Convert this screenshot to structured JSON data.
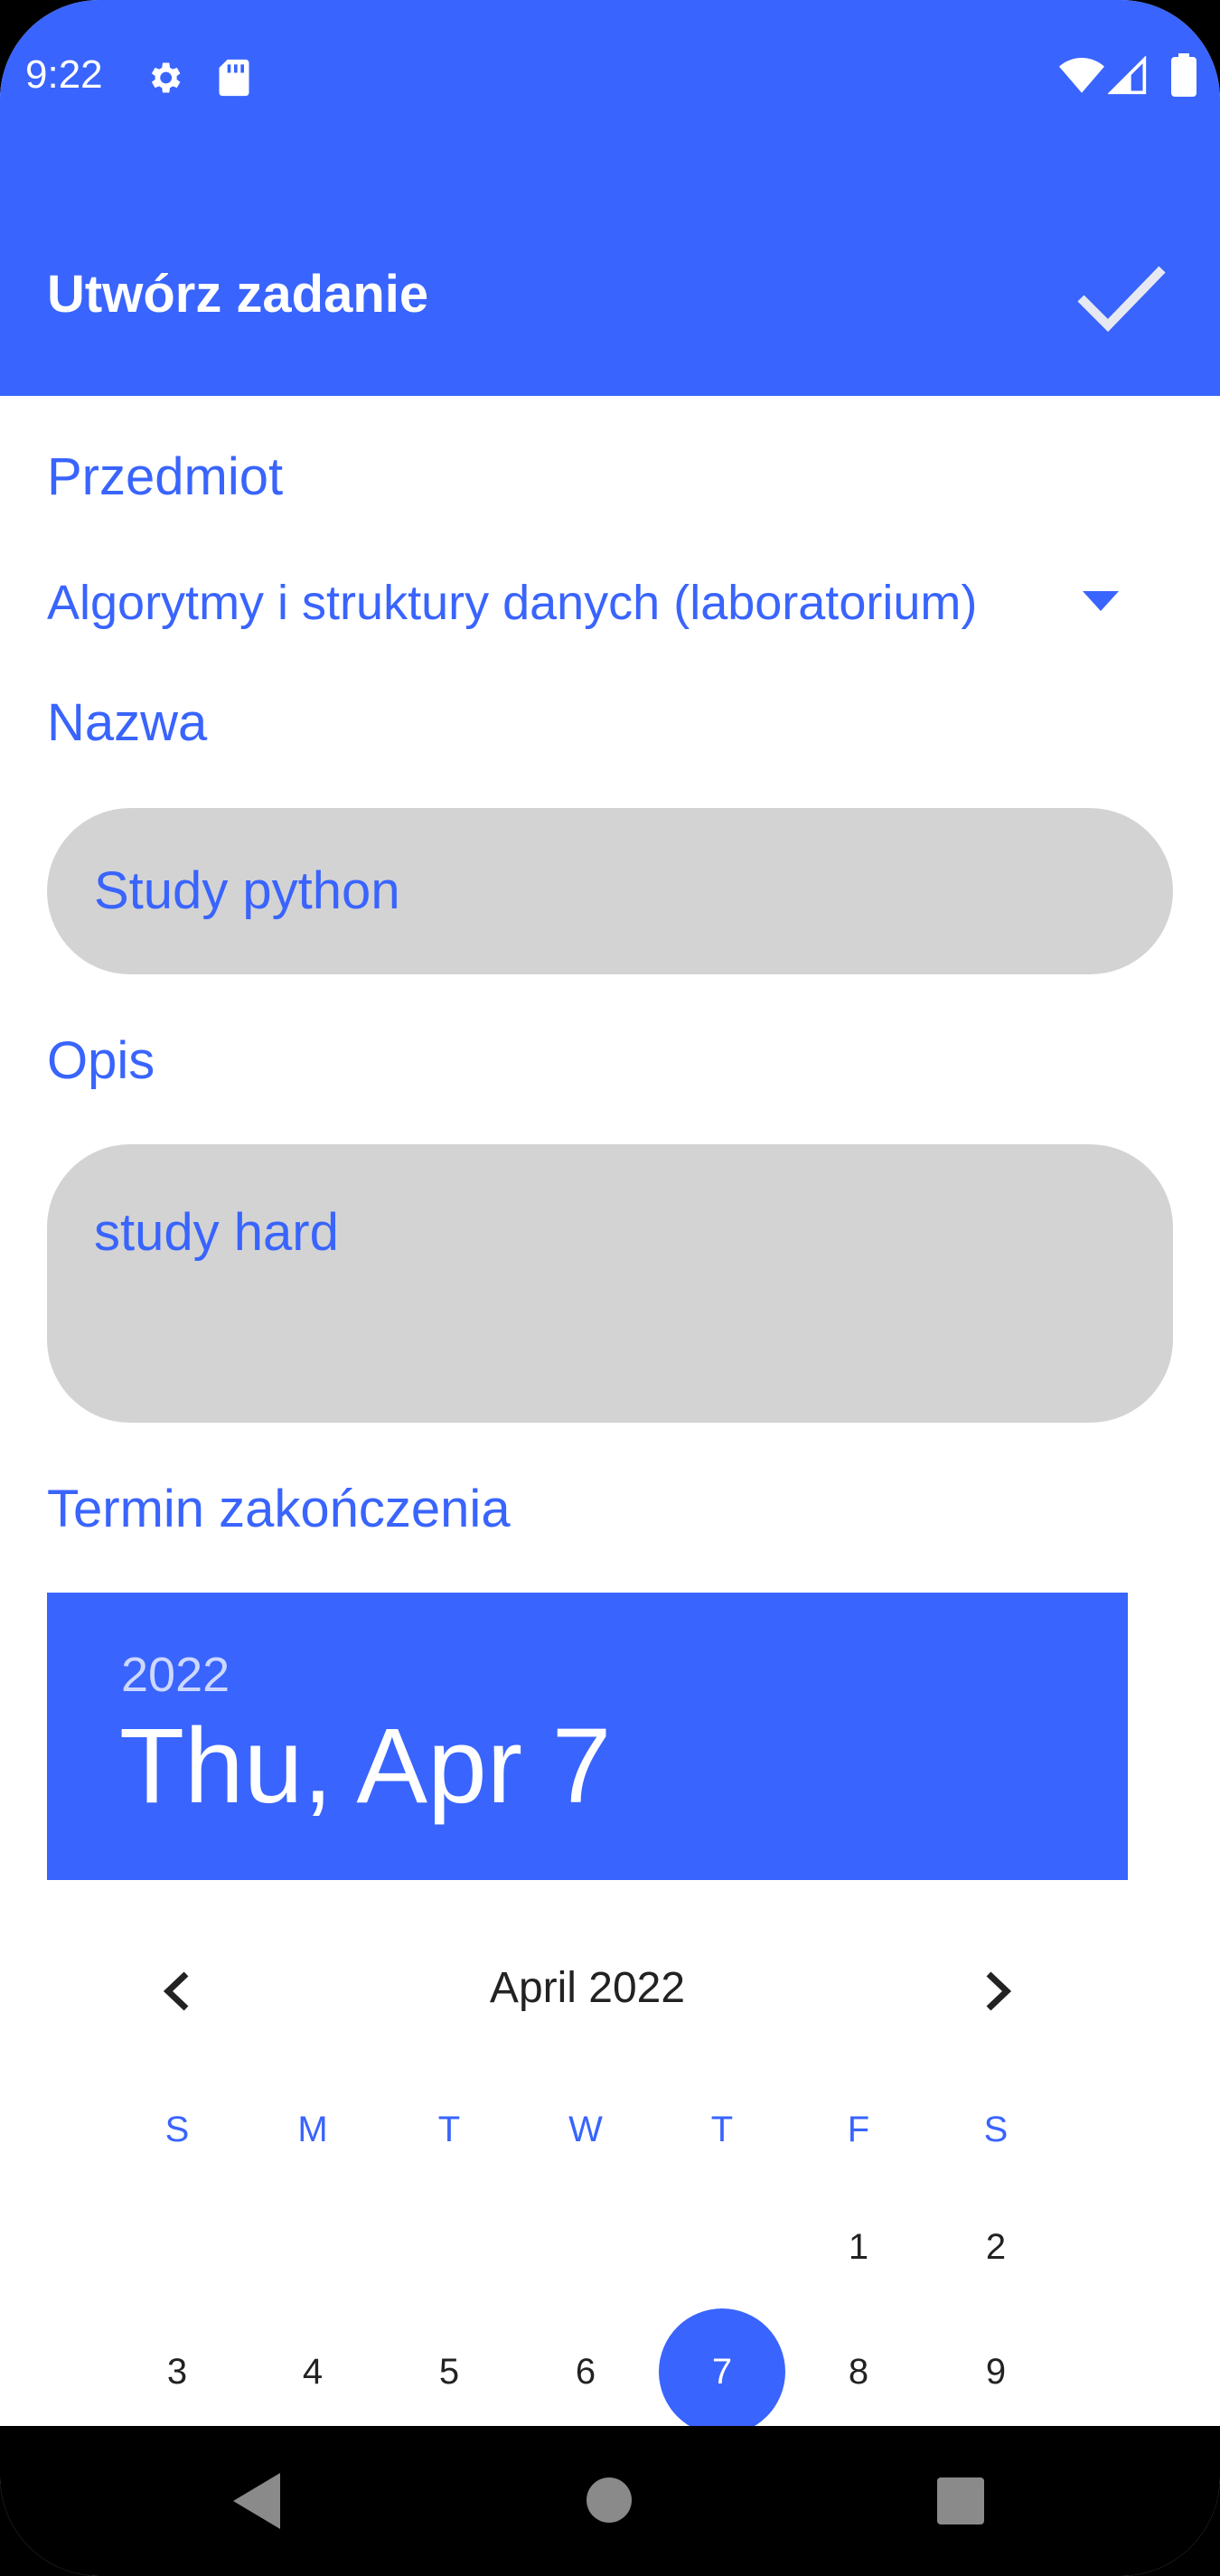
{
  "status_bar": {
    "time": "9:22",
    "icons": [
      "gear-icon",
      "sd-card-icon",
      "wifi-icon",
      "signal-icon",
      "battery-icon"
    ]
  },
  "app_bar": {
    "title": "Utwórz zadanie",
    "confirm_icon": "check-icon"
  },
  "form": {
    "subject_label": "Przedmiot",
    "subject_value": "Algorytmy i struktury danych (laboratorium)",
    "name_label": "Nazwa",
    "name_value": "Study python",
    "description_label": "Opis",
    "description_value": "study hard",
    "deadline_label": "Termin zakończenia"
  },
  "date_picker": {
    "year": "2022",
    "selected_date": "Thu, Apr 7",
    "month_label": "April 2022",
    "weekdays": [
      "S",
      "M",
      "T",
      "W",
      "T",
      "F",
      "S"
    ],
    "days": [
      "1",
      "2",
      "3",
      "4",
      "5",
      "6",
      "7",
      "8",
      "9"
    ],
    "selected_day": "7"
  },
  "colors": {
    "accent": "#3964FD",
    "field_bg": "#D3D3D3",
    "text_dark": "#222222"
  }
}
